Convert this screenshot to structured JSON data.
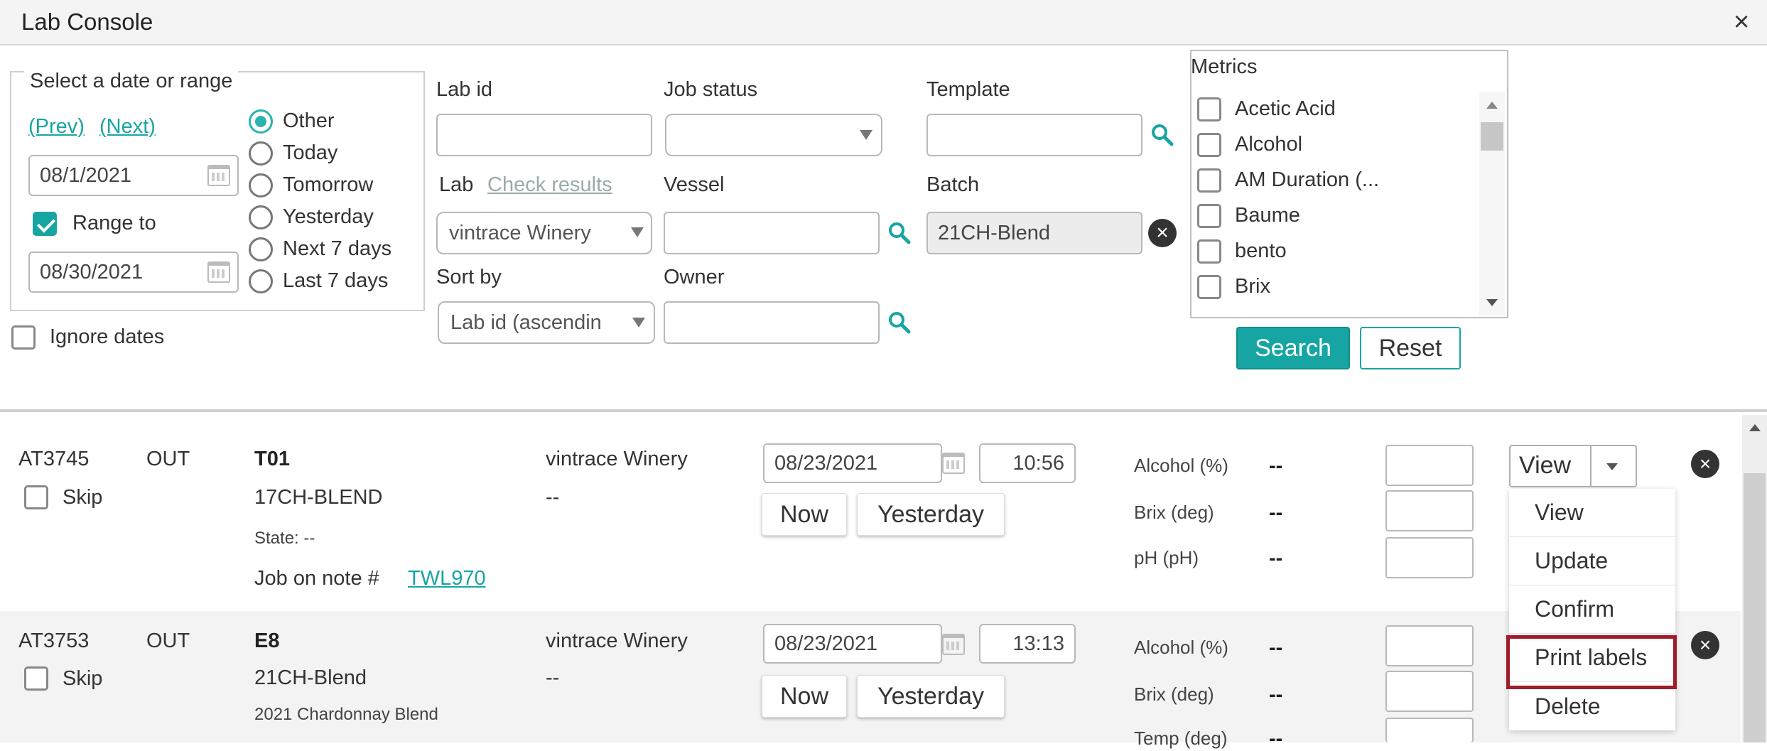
{
  "window": {
    "title": "Lab Console",
    "close_symbol": "×"
  },
  "filters": {
    "date_legend": "Select a date or range",
    "prev_link": "(Prev)",
    "next_link": "(Next)",
    "date_from": "08/1/2021",
    "range_to_label": "Range to",
    "range_to_checked": true,
    "date_to": "08/30/2021",
    "ignore_dates_label": "Ignore dates",
    "ignore_dates_checked": false,
    "date_options": [
      "Other",
      "Today",
      "Tomorrow",
      "Yesterday",
      "Next 7 days",
      "Last 7 days"
    ],
    "selected_date_option": "Other",
    "lab_id_label": "Lab id",
    "lab_id_value": "",
    "job_status_label": "Job status",
    "job_status_value": "",
    "template_label": "Template",
    "template_value": "",
    "lab_label": "Lab",
    "check_results_link": "Check results",
    "lab_value": "vintrace Winery",
    "vessel_label": "Vessel",
    "vessel_value": "",
    "batch_label": "Batch",
    "batch_value": "21CH-Blend",
    "sort_by_label": "Sort by",
    "sort_by_value": "Lab id (ascendin",
    "owner_label": "Owner",
    "owner_value": "",
    "metrics_label": "Metrics",
    "metrics": [
      "Acetic Acid",
      "Alcohol",
      "AM Duration (...",
      "Baume",
      "bento",
      "Brix"
    ],
    "search_button": "Search",
    "reset_button": "Reset"
  },
  "jobs": [
    {
      "lab_id": "AT3745",
      "direction": "OUT",
      "skip_label": "Skip",
      "vessel": "T01",
      "batch": "17CH-BLEND",
      "state": "State: --",
      "note_prefix": "Job on note #",
      "note_link": "TWL970",
      "winery": "vintrace Winery",
      "owner": "--",
      "date": "08/23/2021",
      "time": "10:56",
      "now_button": "Now",
      "yesterday_button": "Yesterday",
      "metrics": [
        {
          "label": "Alcohol (%)",
          "value": "--"
        },
        {
          "label": "Brix (deg)",
          "value": "--"
        },
        {
          "label": "pH (pH)",
          "value": "--"
        }
      ],
      "action_button": "View"
    },
    {
      "lab_id": "AT3753",
      "direction": "OUT",
      "skip_label": "Skip",
      "vessel": "E8",
      "batch": "21CH-Blend",
      "description": "2021 Chardonnay Blend",
      "winery": "vintrace Winery",
      "owner": "--",
      "date": "08/23/2021",
      "time": "13:13",
      "now_button": "Now",
      "yesterday_button": "Yesterday",
      "metrics": [
        {
          "label": "Alcohol (%)",
          "value": "--"
        },
        {
          "label": "Brix (deg)",
          "value": "--"
        },
        {
          "label": "Temp (deg)",
          "value": "--"
        }
      ]
    }
  ],
  "action_menu": [
    "View",
    "Update",
    "Confirm",
    "Print labels",
    "Delete"
  ],
  "highlighted_menu_item": "Print labels",
  "colors": {
    "accent": "#17a5a3",
    "highlight_border": "#a01c2a"
  }
}
